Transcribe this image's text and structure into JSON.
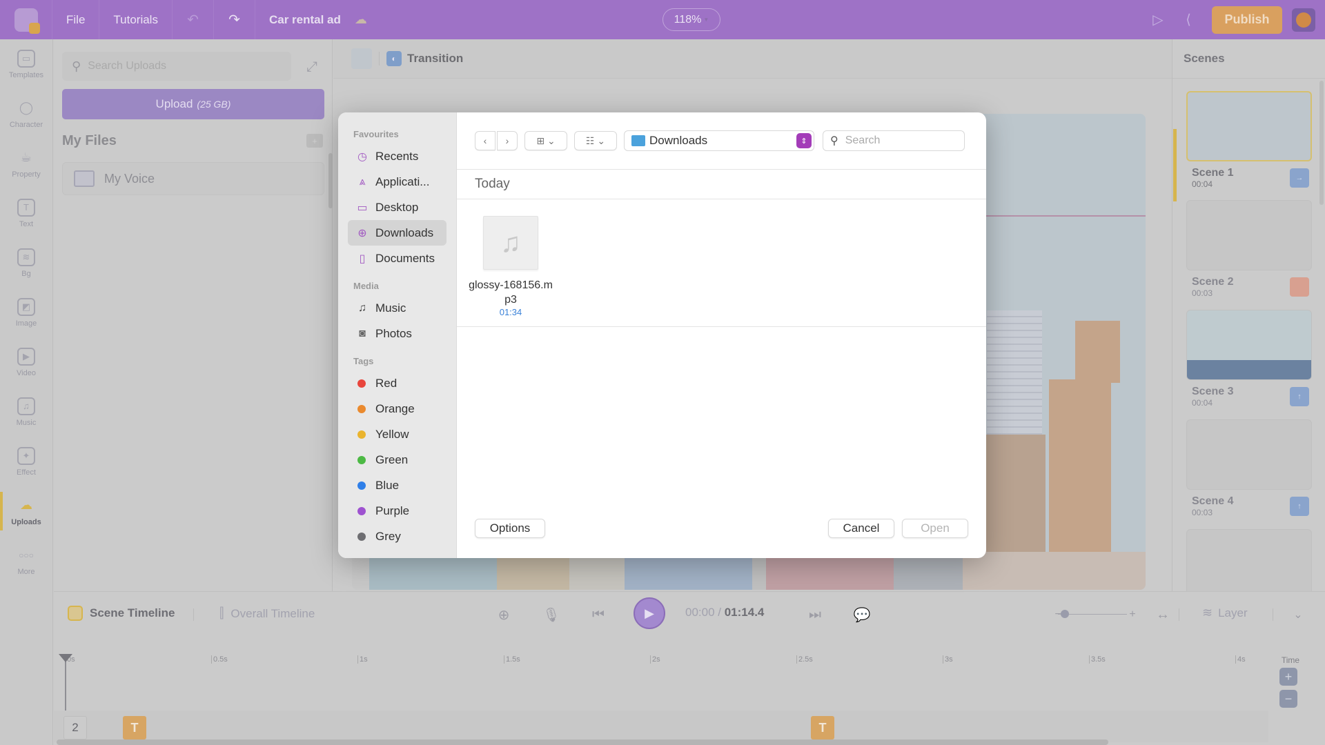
{
  "header": {
    "menu": [
      "File",
      "Tutorials"
    ],
    "project_title": "Car rental ad",
    "zoom_level": "118%",
    "publish_label": "Publish"
  },
  "rail": {
    "items": [
      {
        "label": "Templates",
        "icon": "clapper-icon",
        "glyph": "▭"
      },
      {
        "label": "Character",
        "icon": "person-icon",
        "glyph": "◯"
      },
      {
        "label": "Property",
        "icon": "cup-icon",
        "glyph": "☕"
      },
      {
        "label": "Text",
        "icon": "text-icon",
        "glyph": "T"
      },
      {
        "label": "Bg",
        "icon": "background-icon",
        "glyph": "≋"
      },
      {
        "label": "Image",
        "icon": "image-icon",
        "glyph": "◩"
      },
      {
        "label": "Video",
        "icon": "video-icon",
        "glyph": "▶"
      },
      {
        "label": "Music",
        "icon": "music-icon",
        "glyph": "♫"
      },
      {
        "label": "Effect",
        "icon": "effect-icon",
        "glyph": "✦"
      },
      {
        "label": "Uploads",
        "icon": "cloud-upload-icon",
        "glyph": "☁",
        "active": true
      },
      {
        "label": "More",
        "icon": "more-icon",
        "glyph": "○○○"
      }
    ]
  },
  "uploads": {
    "search_placeholder": "Search Uploads",
    "upload_label": "Upload",
    "upload_quota": "(25 GB)",
    "my_files_title": "My Files",
    "folders": [
      "My Voice"
    ]
  },
  "canvas": {
    "transition_label": "Transition"
  },
  "scenes": {
    "title": "Scenes",
    "items": [
      {
        "name": "Scene 1",
        "duration": "00:04",
        "button": "→"
      },
      {
        "name": "Scene 2",
        "duration": "00:03",
        "button": ""
      },
      {
        "name": "Scene 3",
        "duration": "00:04",
        "button": "↑"
      },
      {
        "name": "Scene 4",
        "duration": "00:03",
        "button": "↑"
      }
    ]
  },
  "timeline": {
    "scene_timeline_label": "Scene Timeline",
    "overall_timeline_label": "Overall Timeline",
    "current_time": "00:00",
    "separator": " / ",
    "total_time": "01:14.4",
    "layer_label": "Layer",
    "ruler_ticks": [
      "0s",
      "0.5s",
      "1s",
      "1.5s",
      "2s",
      "2.5s",
      "3s",
      "3.5s",
      "4s"
    ],
    "time_label": "Time",
    "layer_number": "2",
    "text_block_glyph": "T",
    "zoom_slider_value": 0.1
  },
  "dialog": {
    "sidebar": {
      "favourites_title": "Favourites",
      "favourites": [
        {
          "label": "Recents",
          "icon": "clock-icon",
          "glyph": "◷"
        },
        {
          "label": "Applicati...",
          "icon": "applications-icon",
          "glyph": "⩓"
        },
        {
          "label": "Desktop",
          "icon": "desktop-icon",
          "glyph": "▭"
        },
        {
          "label": "Downloads",
          "icon": "download-icon",
          "glyph": "⊕",
          "selected": true
        },
        {
          "label": "Documents",
          "icon": "document-icon",
          "glyph": "▯"
        }
      ],
      "media_title": "Media",
      "media": [
        {
          "label": "Music",
          "icon": "music-note-icon",
          "glyph": "♫"
        },
        {
          "label": "Photos",
          "icon": "camera-icon",
          "glyph": "◙"
        }
      ],
      "tags_title": "Tags",
      "tags": [
        {
          "label": "Red",
          "color": "#e8453c"
        },
        {
          "label": "Orange",
          "color": "#ea8a2e"
        },
        {
          "label": "Yellow",
          "color": "#eab42e"
        },
        {
          "label": "Green",
          "color": "#4cb944"
        },
        {
          "label": "Blue",
          "color": "#2f7fe8"
        },
        {
          "label": "Purple",
          "color": "#9e52d0"
        },
        {
          "label": "Grey",
          "color": "#6e6e72"
        }
      ]
    },
    "toolbar": {
      "location": "Downloads",
      "search_placeholder": "Search"
    },
    "group_title": "Today",
    "files": [
      {
        "name": "glossy-168156.m\np3",
        "name_line1": "glossy-168156.m",
        "name_line2": "p3",
        "duration": "01:34"
      }
    ],
    "options_label": "Options",
    "cancel_label": "Cancel",
    "open_label": "Open"
  }
}
